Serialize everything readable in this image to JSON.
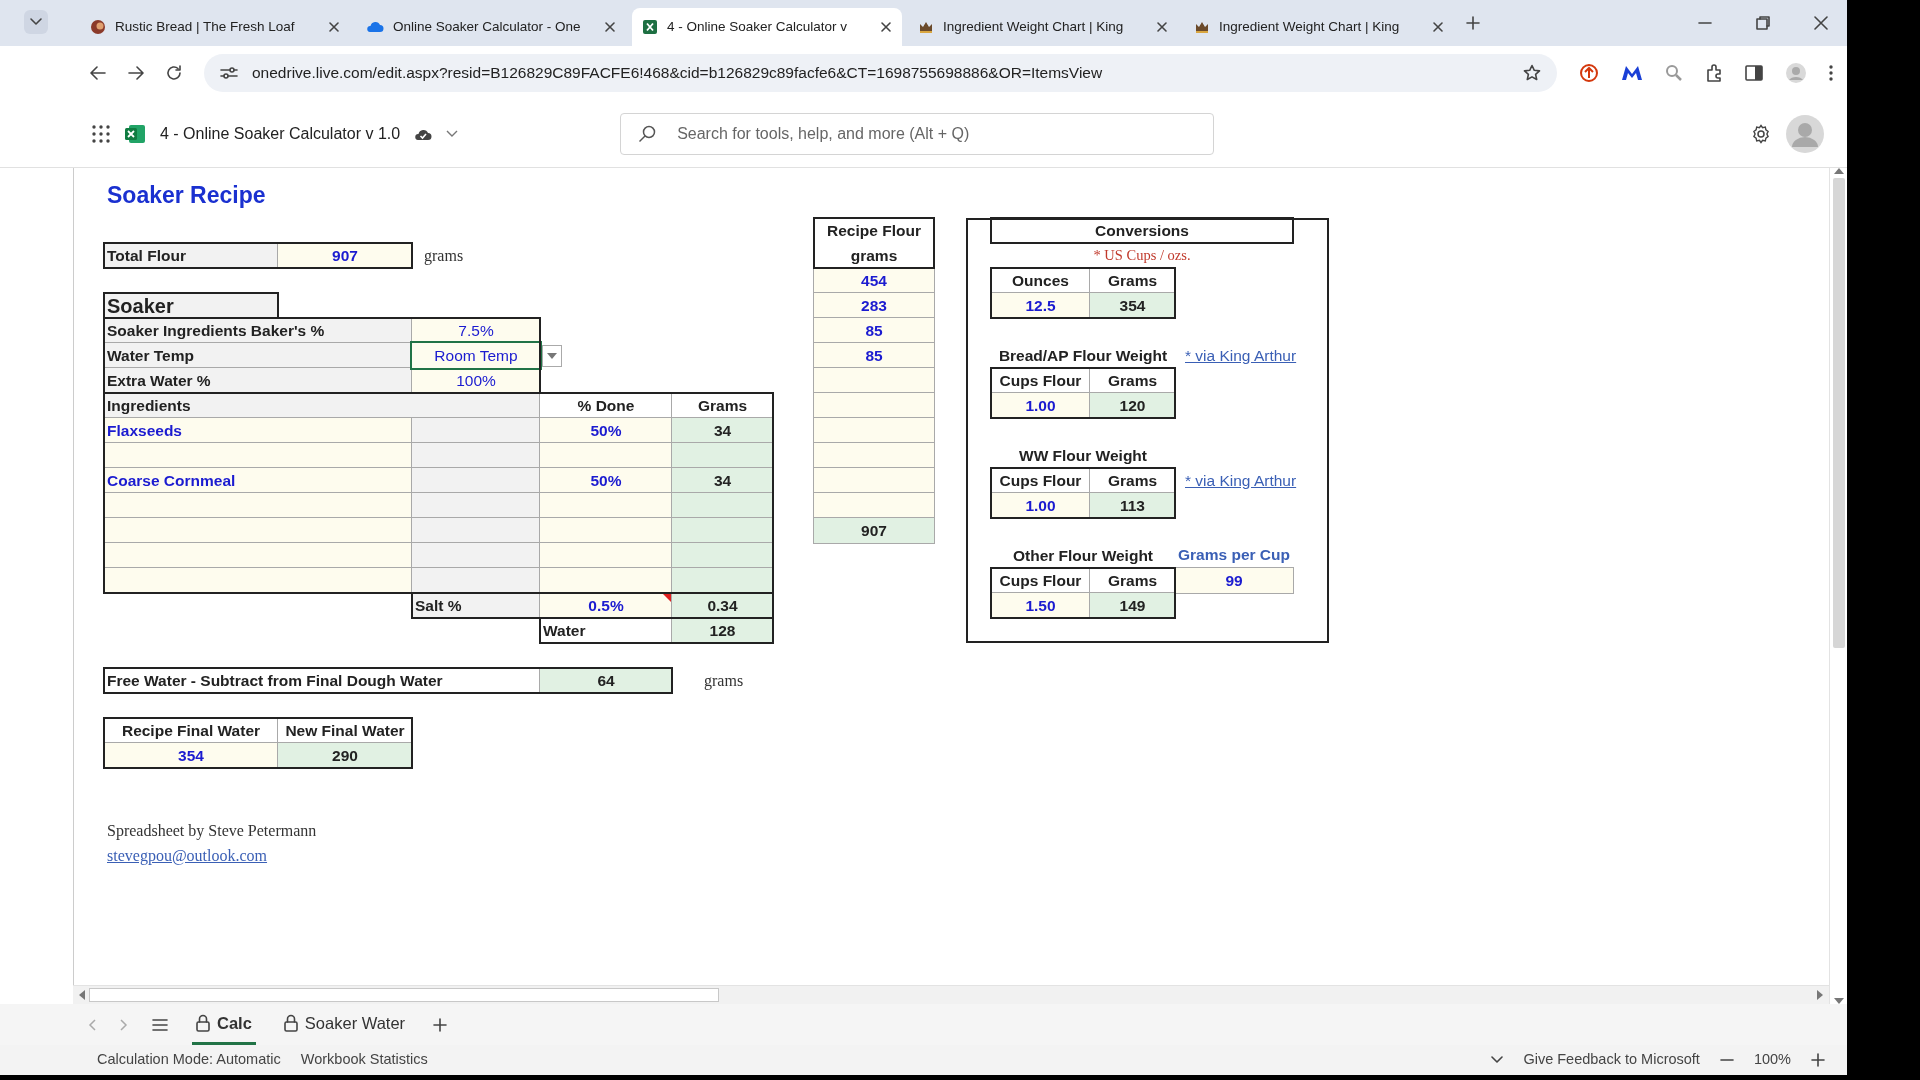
{
  "browser": {
    "tabs": [
      {
        "title": "Rustic Bread | The Fresh Loaf",
        "selected": false
      },
      {
        "title": "Online Soaker Calculator - One",
        "selected": false
      },
      {
        "title": "4 - Online Soaker Calculator v",
        "selected": true
      },
      {
        "title": "Ingredient Weight Chart | King",
        "selected": false
      },
      {
        "title": "Ingredient Weight Chart | King",
        "selected": false
      }
    ],
    "url": "onedrive.live.com/edit.aspx?resid=B126829C89FACFE6!468&cid=b126829c89facfe6&CT=1698755698886&OR=ItemsView"
  },
  "app": {
    "title": "4 - Online Soaker Calculator v 1.0",
    "search": {
      "placeholder": "Search for tools, help, and more (Alt + Q)"
    }
  },
  "sheet": {
    "title": "Soaker Recipe",
    "total_flour": {
      "label": "Total Flour",
      "value": "907",
      "unit": "grams"
    },
    "soaker": {
      "heading": "Soaker",
      "settings": [
        {
          "label": "Soaker Ingredients Baker's %",
          "value": "7.5%",
          "selected": false,
          "dropdown": false
        },
        {
          "label": "Water Temp",
          "value": "Room Temp",
          "selected": true,
          "dropdown": true
        },
        {
          "label": "Extra Water %",
          "value": "100%",
          "selected": false,
          "dropdown": false
        }
      ],
      "columns": [
        "Ingredients",
        "% Done",
        "Grams"
      ],
      "ingredients": [
        {
          "kind": "entry",
          "name": "Flaxseeds",
          "done": "50%",
          "grams": "34"
        },
        {
          "kind": "blank"
        },
        {
          "kind": "entry",
          "name": "Coarse Cornmeal",
          "done": "50%",
          "grams": "34"
        },
        {
          "kind": "blank"
        },
        {
          "kind": "blank"
        },
        {
          "kind": "blank"
        },
        {
          "kind": "blank"
        }
      ],
      "salt": {
        "label": "Salt %",
        "value": "0.5%",
        "grams": "0.34",
        "comment": true
      },
      "water": {
        "label": "Water",
        "grams": "128"
      }
    },
    "free_water": {
      "label": "Free Water - Subtract from Final Dough Water",
      "value": "64",
      "unit": "grams"
    },
    "final_water": {
      "columns": [
        "Recipe Final Water",
        "New Final Water"
      ],
      "values": [
        "354",
        "290"
      ]
    },
    "credit": {
      "text": "Spreadsheet by Steve Petermann",
      "email": "stevegpou@outlook.com"
    },
    "recipe_flour": {
      "heading": "Recipe Flour grams",
      "rows": [
        {
          "kind": "entry",
          "grams": "454"
        },
        {
          "kind": "entry",
          "grams": "283"
        },
        {
          "kind": "entry",
          "grams": "85"
        },
        {
          "kind": "entry",
          "grams": "85"
        },
        {
          "kind": "blank"
        },
        {
          "kind": "blank"
        },
        {
          "kind": "blank"
        },
        {
          "kind": "blank"
        },
        {
          "kind": "blank"
        },
        {
          "kind": "blank"
        }
      ],
      "total": "907"
    },
    "conversions": {
      "title": "Conversions",
      "note": "* US Cups / ozs.",
      "ounces": {
        "columns": [
          "Ounces",
          "Grams"
        ],
        "values": [
          "12.5",
          "354"
        ]
      },
      "groups": [
        {
          "heading": "Bread/AP Flour Weight",
          "heading_link": "* via King Arthur",
          "columns": [
            "Cups Flour",
            "Grams"
          ],
          "values": [
            "1.00",
            "120"
          ]
        },
        {
          "heading": "WW Flour Weight",
          "columns_link": "* via King Arthur",
          "columns": [
            "Cups Flour",
            "Grams"
          ],
          "values": [
            "1.00",
            "113"
          ]
        },
        {
          "heading": "Other Flour Weight",
          "extra": {
            "label": "Grams per Cup",
            "value": "99"
          },
          "columns": [
            "Cups Flour",
            "Grams"
          ],
          "values": [
            "1.50",
            "149"
          ]
        }
      ]
    }
  },
  "sheet_tabs": [
    {
      "label": "Calc",
      "selected": true
    },
    {
      "label": "Soaker Water",
      "selected": false
    }
  ],
  "status_bar": {
    "items": [
      "Calculation Mode: Automatic",
      "Workbook Statistics"
    ],
    "feedback": "Give Feedback to Microsoft",
    "zoom": "100%"
  }
}
